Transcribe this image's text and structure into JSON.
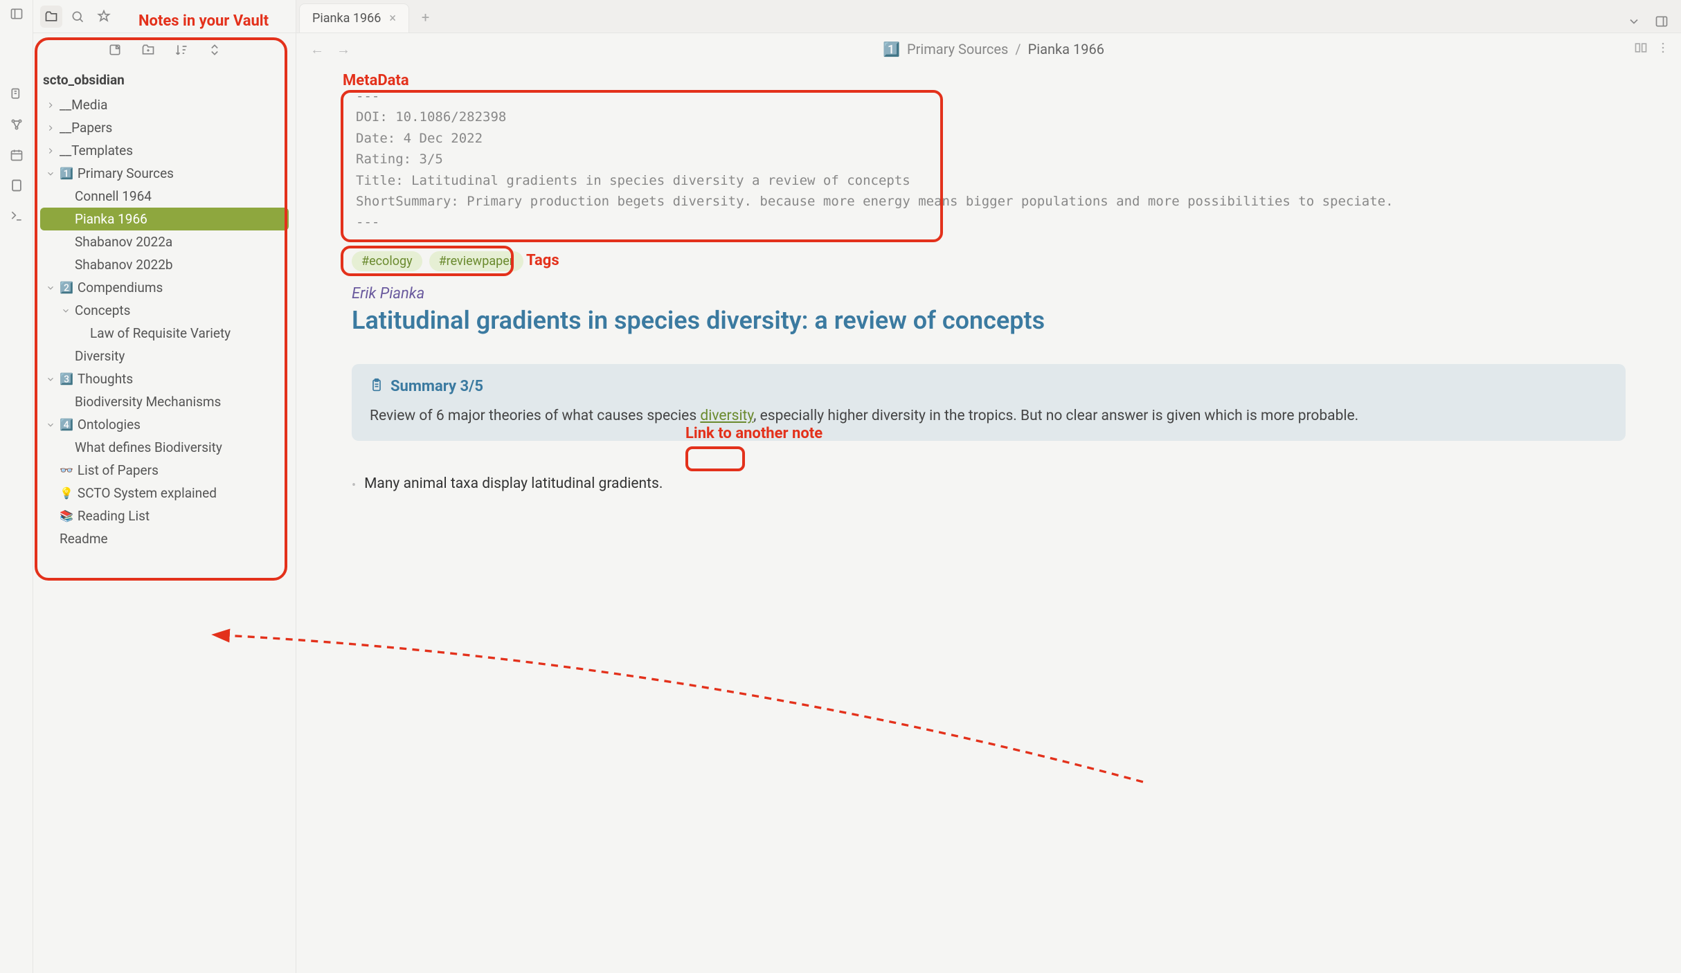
{
  "vault_name": "scto_obsidian",
  "sidebar": {
    "folders": [
      {
        "label": "__Media",
        "chev": "right",
        "indent": 0,
        "emoji": ""
      },
      {
        "label": "__Papers",
        "chev": "right",
        "indent": 0,
        "emoji": ""
      },
      {
        "label": "__Templates",
        "chev": "right",
        "indent": 0,
        "emoji": ""
      },
      {
        "label": "Primary Sources",
        "chev": "down",
        "indent": 0,
        "emoji": "1️⃣"
      },
      {
        "label": "Connell 1964",
        "chev": "",
        "indent": 1,
        "emoji": ""
      },
      {
        "label": "Pianka 1966",
        "chev": "",
        "indent": 1,
        "emoji": "",
        "selected": true
      },
      {
        "label": "Shabanov 2022a",
        "chev": "",
        "indent": 1,
        "emoji": ""
      },
      {
        "label": "Shabanov 2022b",
        "chev": "",
        "indent": 1,
        "emoji": ""
      },
      {
        "label": "Compendiums",
        "chev": "down",
        "indent": 0,
        "emoji": "2️⃣"
      },
      {
        "label": "Concepts",
        "chev": "down",
        "indent": 1,
        "emoji": ""
      },
      {
        "label": "Law of Requisite Variety",
        "chev": "",
        "indent": 2,
        "emoji": ""
      },
      {
        "label": "Diversity",
        "chev": "",
        "indent": 1,
        "emoji": ""
      },
      {
        "label": "Thoughts",
        "chev": "down",
        "indent": 0,
        "emoji": "3️⃣"
      },
      {
        "label": "Biodiversity Mechanisms",
        "chev": "",
        "indent": 1,
        "emoji": ""
      },
      {
        "label": "Ontologies",
        "chev": "down",
        "indent": 0,
        "emoji": "4️⃣"
      },
      {
        "label": "What defines Biodiversity",
        "chev": "",
        "indent": 1,
        "emoji": ""
      },
      {
        "label": "List of Papers",
        "chev": "",
        "indent": 0,
        "emoji": "👓"
      },
      {
        "label": "SCTO System explained",
        "chev": "",
        "indent": 0,
        "emoji": "💡"
      },
      {
        "label": "Reading List",
        "chev": "",
        "indent": 0,
        "emoji": "📚"
      },
      {
        "label": "Readme",
        "chev": "",
        "indent": 0,
        "emoji": ""
      }
    ]
  },
  "tab": {
    "title": "Pianka 1966"
  },
  "breadcrumb": {
    "folder_emoji": "1️⃣",
    "folder": "Primary Sources",
    "sep": "/",
    "current": "Pianka 1966"
  },
  "metadata": {
    "sep": "---",
    "doi_label": "DOI:",
    "doi": "10.1086/282398",
    "date_label": "Date:",
    "date": "4 Dec 2022",
    "rating_label": "Rating:",
    "rating": "3/5",
    "title_label": "Title:",
    "title": "Latitudinal gradients in species diversity a review of concepts",
    "summary_label": "ShortSummary:",
    "summary": "Primary production begets diversity. because more energy means bigger populations and more possibilities to speciate."
  },
  "tags": [
    "#ecology",
    "#reviewpaper"
  ],
  "author": "Erik Pianka",
  "doc_title": "Latitudinal gradients in species diversity: a review of concepts",
  "summary_box": {
    "head": "Summary 3/5",
    "text_before": "Review of 6 major theories of what causes species ",
    "link": "diversity",
    "text_after": ", especially higher diversity in the tropics. But no clear answer is given which is more probable."
  },
  "bullet": "Many animal taxa display latitudinal gradients.",
  "annotations": {
    "vault": "Notes in your Vault",
    "meta": "MetaData",
    "tags": "Tags",
    "link": "Link to another note"
  }
}
